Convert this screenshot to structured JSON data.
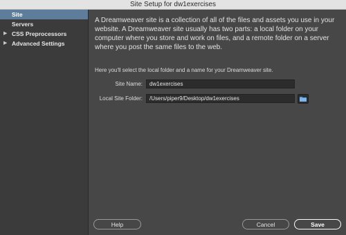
{
  "window": {
    "title": "Site Setup for dw1exercises"
  },
  "sidebar": {
    "items": [
      {
        "label": "Site",
        "selected": true,
        "expandable": false
      },
      {
        "label": "Servers",
        "selected": false,
        "expandable": false
      },
      {
        "label": "CSS Preprocessors",
        "selected": false,
        "expandable": true
      },
      {
        "label": "Advanced Settings",
        "selected": false,
        "expandable": true
      }
    ]
  },
  "main": {
    "intro": "A Dreamweaver site is a collection of all of the files and assets you use in your website. A Dreamweaver site usually has two parts: a local folder on your computer where you store and work on files, and a remote folder on a server where you post the same files to the web.",
    "subtext": "Here you'll select the local folder and a name for your Dreamweaver site.",
    "site_name": {
      "label": "Site Name:",
      "value": "dw1exercises"
    },
    "local_folder": {
      "label": "Local Site Folder:",
      "value": "/Users/piper9/Desktop/dw1exercises"
    }
  },
  "buttons": {
    "help": "Help",
    "cancel": "Cancel",
    "save": "Save"
  },
  "colors": {
    "selection": "#5e7d9a",
    "folder_icon": "#5aa0e0"
  },
  "icons": {
    "folder": "folder-icon",
    "expand": "triangle-right-icon"
  }
}
